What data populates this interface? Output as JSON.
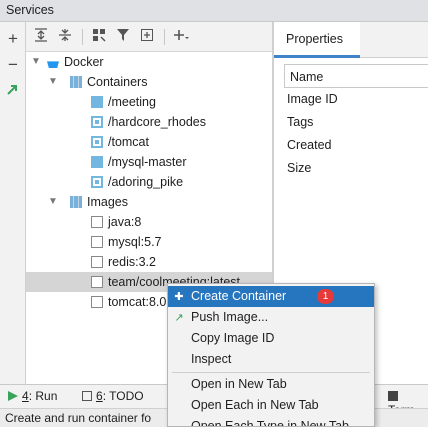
{
  "window": {
    "title": "Services"
  },
  "left_toolbar": {
    "add": "+",
    "remove": "−"
  },
  "tree": {
    "root": {
      "label": "Docker"
    },
    "containers_group": {
      "label": "Containers"
    },
    "containers": [
      {
        "label": "/meeting",
        "state": "running"
      },
      {
        "label": "/hardcore_rhodes",
        "state": "stopped"
      },
      {
        "label": "/tomcat",
        "state": "stopped"
      },
      {
        "label": "/mysql-master",
        "state": "running"
      },
      {
        "label": "/adoring_pike",
        "state": "stopped"
      }
    ],
    "images_group": {
      "label": "Images"
    },
    "images": [
      {
        "label": "java:8"
      },
      {
        "label": "mysql:5.7"
      },
      {
        "label": "redis:3.2"
      },
      {
        "label": "team/coolmeeting:latest",
        "selected": true
      },
      {
        "label": "tomcat:8.0"
      }
    ]
  },
  "properties": {
    "tab": "Properties",
    "header": "Name",
    "rows": [
      "Image ID",
      "Tags",
      "Created",
      "Size"
    ]
  },
  "context_menu": {
    "items": [
      {
        "label": "Create Container",
        "highlighted": true,
        "badge": "1"
      },
      {
        "label": "Push Image..."
      },
      {
        "label": "Copy Image ID"
      },
      {
        "label": "Inspect"
      },
      {
        "label": "Open in New Tab"
      },
      {
        "label": "Open Each in New Tab"
      },
      {
        "label": "Open Each Type in New Tab"
      }
    ]
  },
  "bottom_tabs": [
    {
      "num": "4",
      "label": ": Run"
    },
    {
      "num": "6",
      "label": ": TODO"
    },
    {
      "label": "Term"
    }
  ],
  "status": {
    "text": "Create and run container fo"
  },
  "colors": {
    "accent": "#2675bf",
    "badge": "#e5393a",
    "docker": "#2496ed"
  }
}
